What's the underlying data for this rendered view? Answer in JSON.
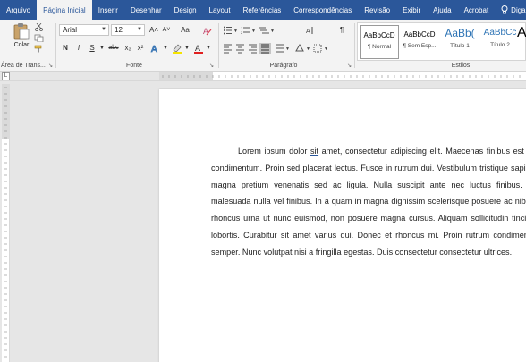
{
  "tabs": [
    "Arquivo",
    "Página Inicial",
    "Inserir",
    "Desenhar",
    "Design",
    "Layout",
    "Referências",
    "Correspondências",
    "Revisão",
    "Exibir",
    "Ajuda",
    "Acrobat"
  ],
  "active_tab": "Página Inicial",
  "search_label": "Diga-",
  "ribbon": {
    "clipboard": {
      "paste_label": "Colar",
      "group_label": "Área de Trans..."
    },
    "font": {
      "font_name": "Arial",
      "font_size": "12",
      "grow": "A˄",
      "shrink": "A˅",
      "change_case": "Aa",
      "bold": "N",
      "italic": "I",
      "underline": "S",
      "strike": "abc",
      "subscript": "x₂",
      "superscript": "x²",
      "group_label": "Fonte"
    },
    "paragraph": {
      "group_label": "Parágrafo",
      "pilcrow": "¶"
    },
    "styles": {
      "items": [
        {
          "sample": "AaBbCcD",
          "name": "¶ Normal"
        },
        {
          "sample": "AaBbCcD",
          "name": "¶ Sem Esp..."
        },
        {
          "sample": "AaBb(",
          "name": "Título 1"
        },
        {
          "sample": "AaBbCc",
          "name": "Título 2"
        },
        {
          "sample": "A",
          "name": ""
        }
      ],
      "group_label": "Estilos"
    }
  },
  "ruler_corner": "L",
  "document": {
    "before": "Lorem ipsum dolor ",
    "misspelled": "sit",
    "after": " amet, consectetur adipiscing elit. Maecenas finibus est quis condimentum. Proin sed placerat lectus. Fusce in rutrum dui. Vestibulum tristique sapien a magna pretium venenatis sed ac ligula. Nulla suscipit ante nec luctus finibus. Sed malesuada nulla vel finibus. In a quam in magna dignissim scelerisque posuere ac nibh. In rhoncus urna ut nunc euismod, non posuere magna cursus. Aliquam sollicitudin tincidunt lobortis. Curabitur sit amet varius dui. Donec et rhoncus mi. Proin rutrum condimentum semper. Nunc volutpat nisi a fringilla egestas. Duis consectetur consectetur ultrices."
  },
  "colors": {
    "accent": "#2b579a",
    "ribbon_bg": "#f3f3f3",
    "canvas_bg": "#e6e6e6"
  }
}
